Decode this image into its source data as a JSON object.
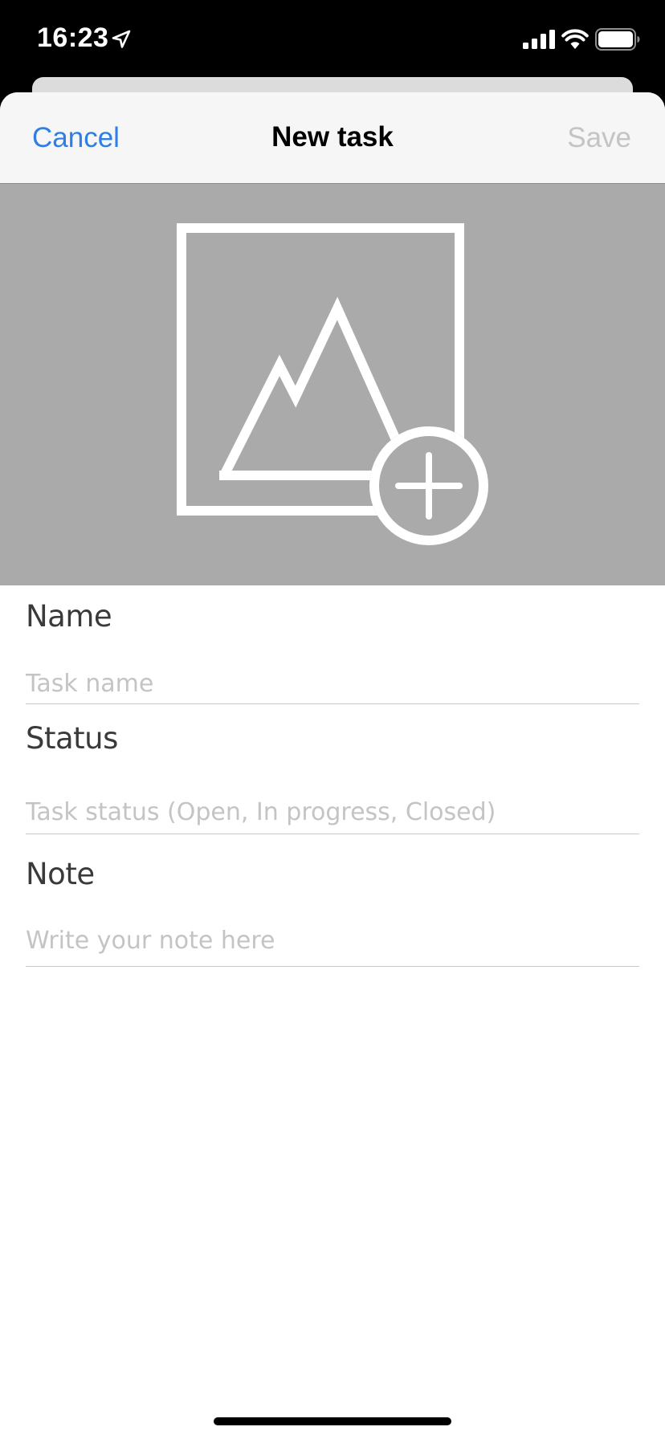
{
  "status_bar": {
    "time": "16:23"
  },
  "nav": {
    "cancel_label": "Cancel",
    "title": "New task",
    "save_label": "Save"
  },
  "image_picker": {
    "icon": "add-image-icon"
  },
  "form": {
    "name": {
      "label": "Name",
      "placeholder": "Task name",
      "value": ""
    },
    "status": {
      "label": "Status",
      "placeholder": "Task status (Open, In progress, Closed)",
      "value": ""
    },
    "note": {
      "label": "Note",
      "placeholder": "Write your note here",
      "value": ""
    }
  },
  "colors": {
    "accent": "#2f7ee6",
    "disabled": "#c4c4c7",
    "image_background": "#aaaaaa"
  }
}
